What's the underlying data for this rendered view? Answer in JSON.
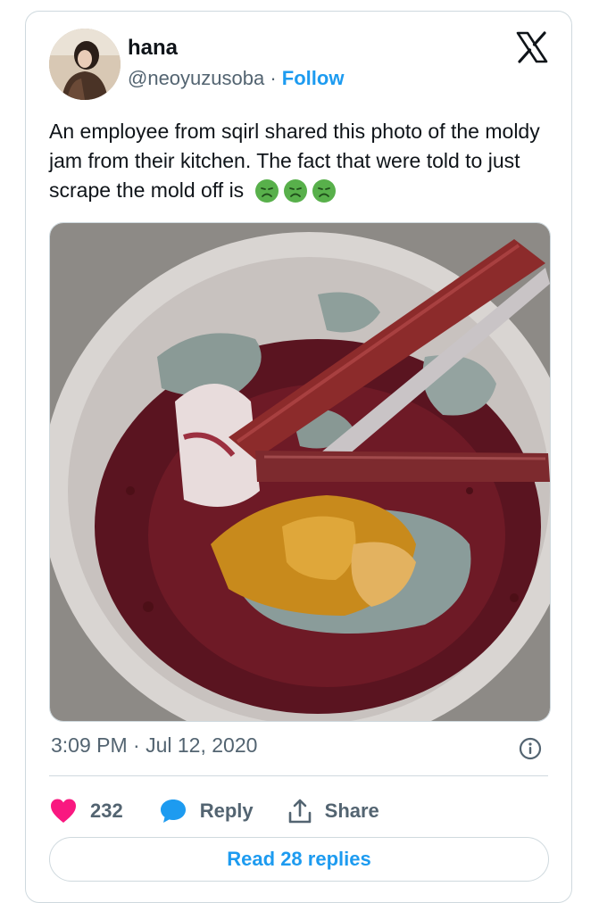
{
  "author": {
    "display_name": "hana",
    "handle": "@neoyuzusoba",
    "separator": "·",
    "follow_label": "Follow"
  },
  "tweet": {
    "text": "An employee from sqirl shared this photo of the moldy jam from their kitchen. The fact that were told to just scrape the mold off is",
    "emoji": [
      "nauseated-face",
      "nauseated-face",
      "nauseated-face"
    ],
    "timestamp": "3:09 PM · Jul 12, 2020"
  },
  "actions": {
    "like_count": "232",
    "reply_label": "Reply",
    "share_label": "Share",
    "read_replies_label": "Read 28 replies"
  },
  "colors": {
    "accent": "#1d9bf0",
    "like": "#f91880",
    "muted": "#536471",
    "border": "#cfd9de"
  }
}
